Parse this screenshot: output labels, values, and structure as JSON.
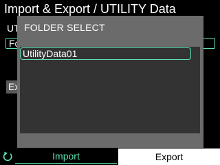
{
  "colors": {
    "accent": "#5ee2b0",
    "dialog_bg": "#6b6b6b",
    "list_bg": "#333333",
    "screen_bg": "#000000"
  },
  "background": {
    "title": "Import & Export / UTILITY Data",
    "label_partial": "UT",
    "folder_field_partial": "Fo",
    "export_button_partial": "Ex"
  },
  "dialog": {
    "title": "FOLDER SELECT",
    "folders": [
      "UtilityData01"
    ]
  },
  "footer": {
    "back_icon": "back-arrow-icon",
    "tabs": [
      {
        "label": "Import",
        "selected": true
      },
      {
        "label": "Export",
        "selected": false
      }
    ]
  }
}
